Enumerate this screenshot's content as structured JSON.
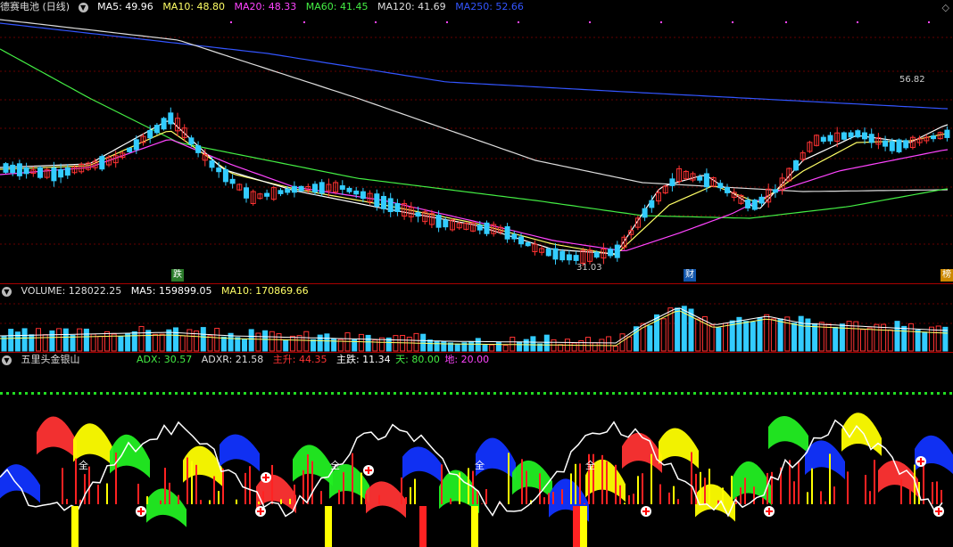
{
  "main": {
    "title": "德赛电池 (日线)",
    "ma": [
      {
        "label": "MA5: 49.96",
        "color": "#ffffff"
      },
      {
        "label": "MA10: 48.80",
        "color": "#ffff66"
      },
      {
        "label": "MA20: 48.33",
        "color": "#ff44ff"
      },
      {
        "label": "MA60: 41.45",
        "color": "#44ee44"
      },
      {
        "label": "MA120: 41.69",
        "color": "#dddddd"
      },
      {
        "label": "MA250: 52.66",
        "color": "#3355ff"
      }
    ],
    "high_label": "56.82",
    "low_label": "31.03",
    "event_marks": {
      "die": "跌",
      "cai": "财",
      "bang": "榜"
    },
    "collapse_icon": "◇"
  },
  "volume": {
    "label": "VOLUME: 128022.25",
    "ma5": "MA5: 159899.05",
    "ma10": "MA10: 170869.66"
  },
  "indicator": {
    "name": "五里头金银山",
    "adx": "ADX: 30.57",
    "adxr": "ADXR: 21.58",
    "zhusheng": "主升: 44.35",
    "zhudie": "主跌: 11.34",
    "tian": "天: 80.00",
    "di": "地: 20.00",
    "signal_text": "全仓"
  },
  "colors": {
    "up": "#ff3333",
    "down": "#33ccff",
    "grid": "#880000"
  }
}
